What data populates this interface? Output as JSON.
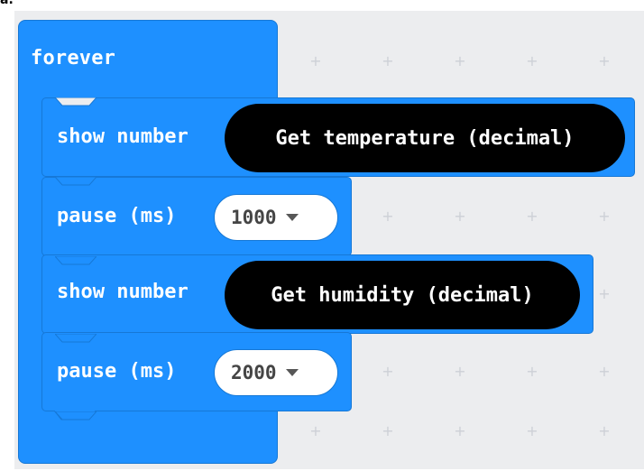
{
  "workspace": {
    "corner_text": "a."
  },
  "forever": {
    "label": "forever"
  },
  "blocks": [
    {
      "type": "show_number",
      "label": "show number",
      "reporter": "Get temperature (decimal)"
    },
    {
      "type": "pause",
      "label": "pause (ms)",
      "value": "1000"
    },
    {
      "type": "show_number",
      "label": "show number",
      "reporter": "Get humidity (decimal)"
    },
    {
      "type": "pause",
      "label": "pause (ms)",
      "value": "2000"
    }
  ],
  "colors": {
    "block_blue": "#1e90ff",
    "block_border": "#1678d6",
    "reporter_black": "#000000",
    "canvas": "#ecedef"
  }
}
